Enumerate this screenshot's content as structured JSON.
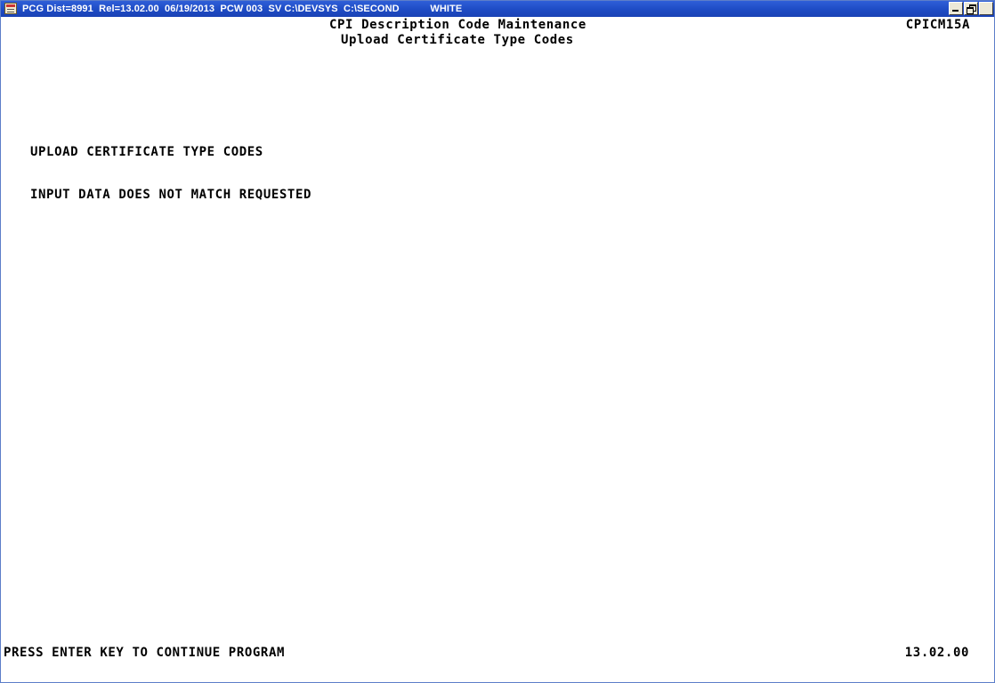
{
  "window": {
    "title": "PCG Dist=8991  Rel=13.02.00  06/19/2013  PCW 003  SV C:\\DEVSYS  C:\\SECOND           WHITE",
    "controls": {
      "minimize": "",
      "restore": "",
      "close": "×"
    }
  },
  "screen": {
    "title": "CPI Description Code Maintenance",
    "subtitle": "Upload Certificate Type Codes",
    "program_id": "CPICM15A",
    "section_title": "UPLOAD CERTIFICATE TYPE CODES",
    "message": "INPUT DATA DOES NOT MATCH REQUESTED",
    "status_prompt": "PRESS ENTER KEY TO CONTINUE PROGRAM",
    "version": "13.02.00"
  }
}
